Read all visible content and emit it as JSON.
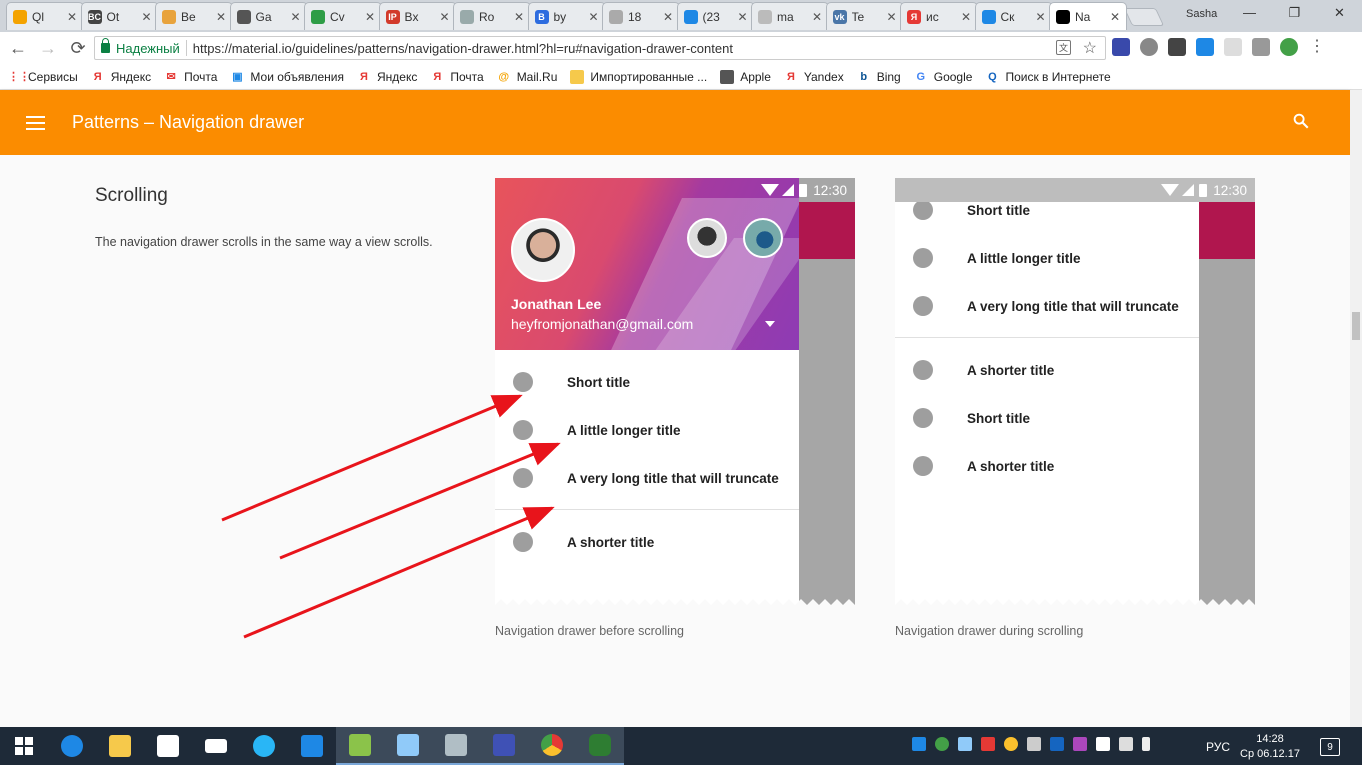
{
  "browser": {
    "tabs": [
      {
        "title": "Ql",
        "color": "#f4a300",
        "glyph": ""
      },
      {
        "title": "Ot",
        "color": "#444",
        "glyph": "BC"
      },
      {
        "title": "Be",
        "color": "#e8a33c",
        "glyph": ""
      },
      {
        "title": "Ga",
        "color": "#555",
        "glyph": ""
      },
      {
        "title": "Cv",
        "color": "#2e9d46",
        "glyph": ""
      },
      {
        "title": "Bx",
        "color": "#d23a2a",
        "glyph": "IP"
      },
      {
        "title": "Ro",
        "color": "#9aa",
        "glyph": ""
      },
      {
        "title": "by",
        "color": "#2d6cdf",
        "glyph": "B"
      },
      {
        "title": "18",
        "color": "#aaa",
        "glyph": ""
      },
      {
        "title": "(23",
        "color": "#1e88e5",
        "glyph": ""
      },
      {
        "title": "ma",
        "color": "#bbb",
        "glyph": ""
      },
      {
        "title": "Te",
        "color": "#4a76a8",
        "glyph": "vk"
      },
      {
        "title": "ис",
        "color": "#e53935",
        "glyph": "Я"
      },
      {
        "title": "Ск",
        "color": "#1e88e5",
        "glyph": ""
      },
      {
        "title": "Na",
        "color": "#000",
        "glyph": ""
      }
    ],
    "user": "Sasha",
    "secure_label": "Надежный",
    "url": "https://material.io/guidelines/patterns/navigation-drawer.html?hl=ru#navigation-drawer-content",
    "bookmarks": [
      {
        "label": "Сервисы",
        "icon": "apps-icon",
        "color": "#e53935",
        "glyph": "⋮⋮"
      },
      {
        "label": "Яндекс",
        "icon": "yandex-icon",
        "color": "#e53935",
        "glyph": "Я"
      },
      {
        "label": "Почта",
        "icon": "mail-icon",
        "color": "#e53935",
        "glyph": "✉"
      },
      {
        "label": "Мои объявления",
        "icon": "ads-icon",
        "color": "#1e88e5",
        "glyph": "▣"
      },
      {
        "label": "Яндекс",
        "icon": "yandex-icon",
        "color": "#e53935",
        "glyph": "Я"
      },
      {
        "label": "Почта",
        "icon": "yandex-mail-icon",
        "color": "#e53935",
        "glyph": "Я"
      },
      {
        "label": "Mail.Ru",
        "icon": "mailru-icon",
        "color": "#f4a300",
        "glyph": "@"
      },
      {
        "label": "Импортированные ...",
        "icon": "folder-icon",
        "color": "#f6c94b",
        "glyph": ""
      },
      {
        "label": "Apple",
        "icon": "apple-icon",
        "color": "#555",
        "glyph": ""
      },
      {
        "label": "Yandex",
        "icon": "yandex-icon",
        "color": "#e53935",
        "glyph": "Я"
      },
      {
        "label": "Bing",
        "icon": "bing-icon",
        "color": "#0b5394",
        "glyph": "b"
      },
      {
        "label": "Google",
        "icon": "google-icon",
        "color": "#4285f4",
        "glyph": "G"
      },
      {
        "label": "Поиск в Интернете",
        "icon": "web-search-icon",
        "color": "#1565c0",
        "glyph": "Q"
      }
    ]
  },
  "appbar": {
    "title": "Patterns  –  Navigation drawer",
    "color": "#fb8c00"
  },
  "section": {
    "heading": "Scrolling",
    "body": "The navigation drawer scrolls in the same way a view scrolls."
  },
  "phone_before": {
    "time": "12:30",
    "user_name": "Jonathan Lee",
    "user_email": "heyfromjonathan@gmail.com",
    "items_top": [
      "Short title",
      "A little longer title",
      "A very long title that will truncate"
    ],
    "items_bottom": [
      "A shorter title"
    ],
    "caption": "Navigation drawer before scrolling"
  },
  "phone_during": {
    "time": "12:30",
    "items_top": [
      "Short title",
      "A little longer title",
      "A very long title that will truncate"
    ],
    "items_bottom": [
      "A shorter title",
      "Short title",
      "A shorter title"
    ],
    "caption": "Navigation drawer during scrolling"
  },
  "taskbar": {
    "language": "РУС",
    "time": "14:28",
    "date": "Ср 06.12.17",
    "notifications": "9"
  }
}
